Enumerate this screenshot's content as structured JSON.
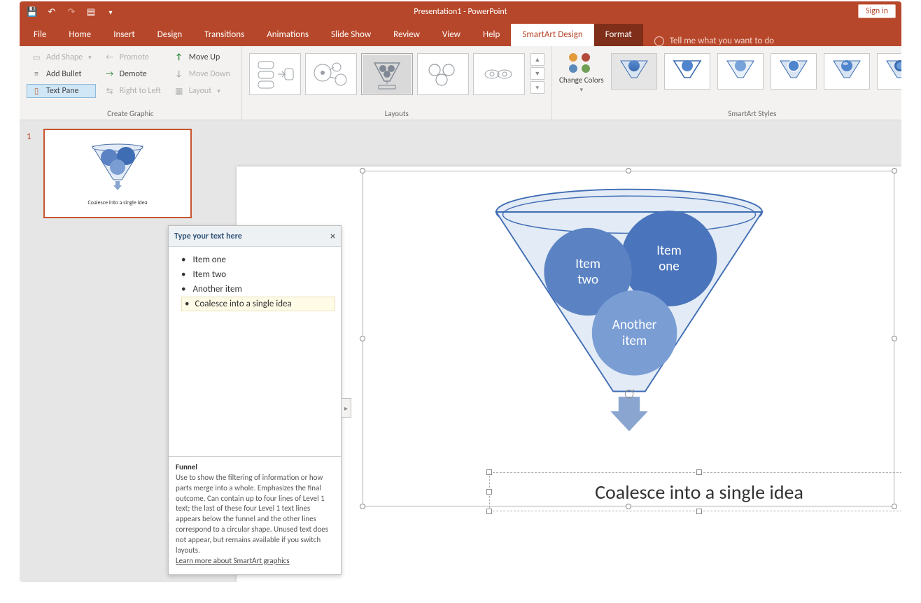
{
  "title": "Presentation1 - PowerPoint",
  "signin": "Sign in",
  "tabs": [
    "File",
    "Home",
    "Insert",
    "Design",
    "Transitions",
    "Animations",
    "Slide Show",
    "Review",
    "View",
    "Help",
    "SmartArt Design",
    "Format"
  ],
  "tellme": "Tell me what you want to do",
  "groups": {
    "create": {
      "add_shape": "Add Shape",
      "add_bullet": "Add Bullet",
      "text_pane": "Text Pane",
      "promote": "Promote",
      "demote": "Demote",
      "rtl": "Right to Left",
      "move_up": "Move Up",
      "move_down": "Move Down",
      "layout": "Layout",
      "label": "Create Graphic"
    },
    "layouts_label": "Layouts",
    "change_colors": "Change Colors",
    "styles_label": "SmartArt Styles"
  },
  "slide_number": "1",
  "thumb_caption": "Coalesce into a single idea",
  "textpane": {
    "title": "Type your text here",
    "items": [
      "Item one",
      "Item two",
      "Another item",
      "Coalesce into a single idea"
    ],
    "desc_title": "Funnel",
    "desc_body": "Use to show the filtering of information or how parts merge into a whole. Emphasizes the final outcome. Can contain up to four lines of Level 1 text; the last of these four Level 1 text lines appears below the funnel and the other lines  correspond to a circular shape. Unused text does not appear, but remains available if you switch layouts.",
    "desc_link": "Learn more about SmartArt graphics"
  },
  "smartart": {
    "item1": "Item one",
    "item2": "Item two",
    "item3": "Another item",
    "coalesce": "Coalesce into a single idea"
  }
}
